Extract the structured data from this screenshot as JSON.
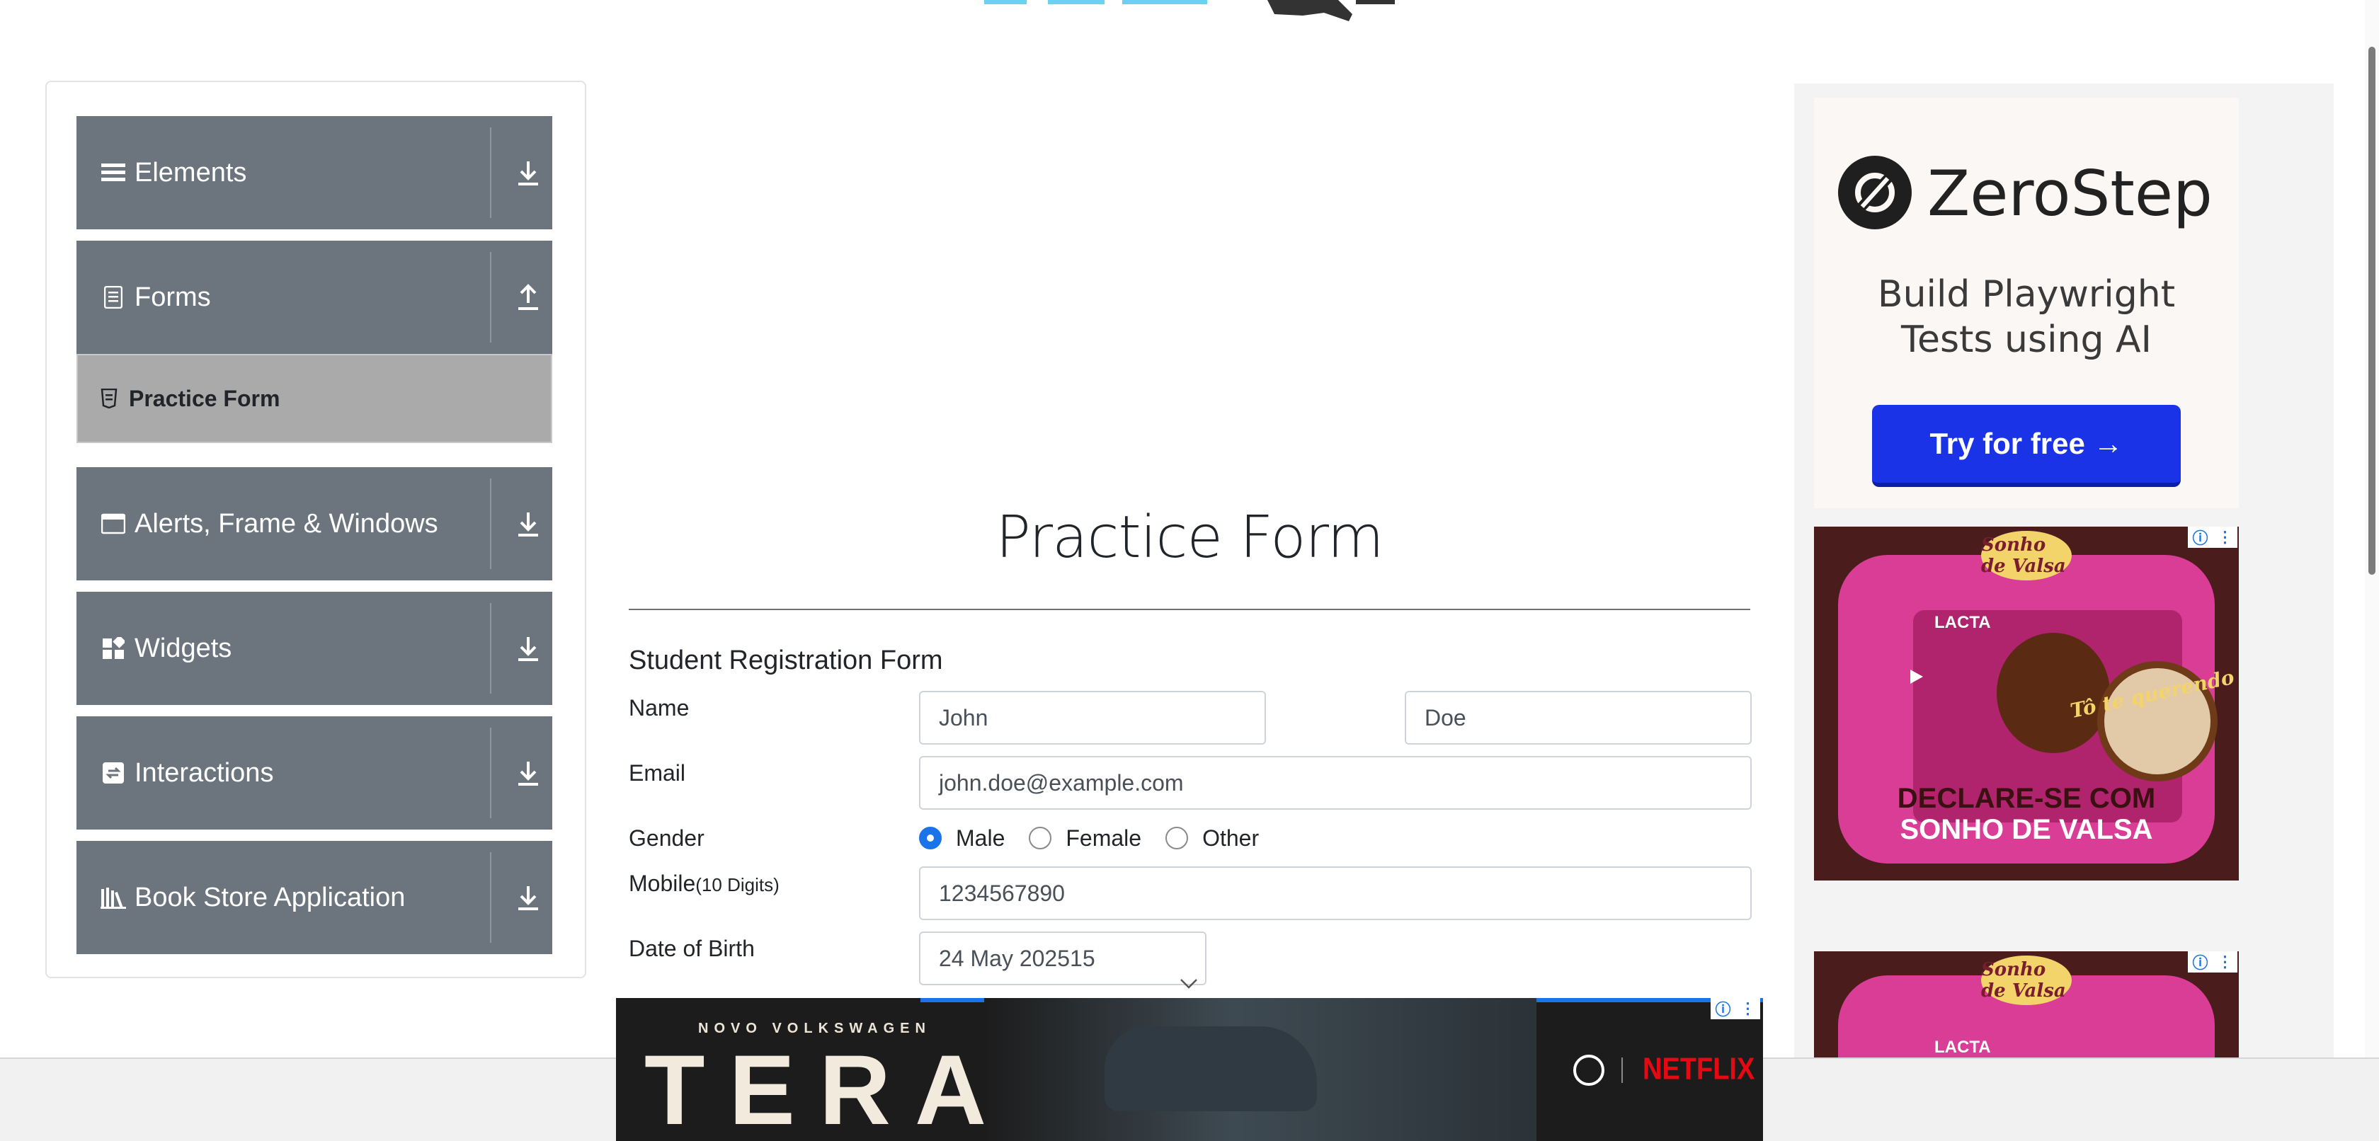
{
  "sidebar": {
    "groups": [
      {
        "label": "Elements",
        "icon": "hamburger-icon",
        "arrow": "download-icon"
      },
      {
        "label": "Forms",
        "icon": "document-icon",
        "arrow": "upload-icon"
      },
      {
        "label": "Alerts, Frame & Windows",
        "icon": "window-icon",
        "arrow": "download-icon"
      },
      {
        "label": "Widgets",
        "icon": "widgets-icon",
        "arrow": "download-icon"
      },
      {
        "label": "Interactions",
        "icon": "swap-icon",
        "arrow": "download-icon"
      },
      {
        "label": "Book Store Application",
        "icon": "books-icon",
        "arrow": "download-icon"
      }
    ],
    "forms_sub": {
      "label": "Practice Form",
      "icon": "html5-icon"
    }
  },
  "main": {
    "title": "Practice Form",
    "form_heading": "Student Registration Form",
    "name_label": "Name",
    "first_name": "John",
    "last_name": "Doe",
    "email_label": "Email",
    "email": "john.doe@example.com",
    "gender_label": "Gender",
    "gender_options": [
      "Male",
      "Female",
      "Other"
    ],
    "gender_selected": "Male",
    "mobile_label": "Mobile",
    "mobile_hint": "(10 Digits)",
    "mobile": "1234567890",
    "dob_label": "Date of Birth",
    "dob": "24 May 202515"
  },
  "ads": {
    "zerostep": {
      "brand": "ZeroStep",
      "tagline_1": "Build Playwright",
      "tagline_2": "Tests using AI",
      "cta": "Try for free →"
    },
    "sonho": {
      "brand": "Sonho de Valsa",
      "maker": "LACTA",
      "slogan": "Tô te querendo",
      "cta_line1": "DECLARE-SE COM",
      "cta_line2": "SONHO DE VALSA"
    },
    "banner": {
      "kicker": "NOVO VOLKSWAGEN",
      "model": "TERA",
      "partner": "NETFLIX"
    }
  },
  "colors": {
    "sidebar_group": "#6c757d",
    "sidebar_active": "#aaaaaa",
    "radio_checked": "#1a73e8",
    "ad_button": "#1a33e6",
    "ad_pink": "#d93d96"
  }
}
